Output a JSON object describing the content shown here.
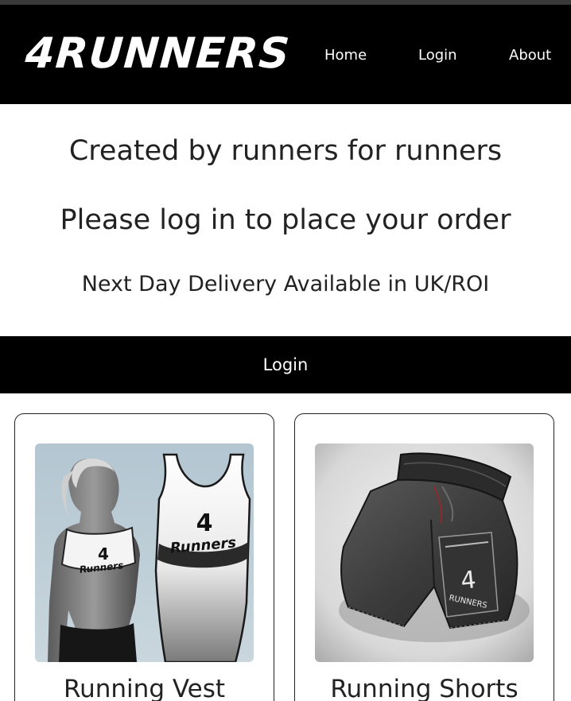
{
  "header": {
    "logo": "4RUNNERS",
    "nav": {
      "home": "Home",
      "login": "Login",
      "about": "About"
    }
  },
  "hero": {
    "line1": "Created by runners for runners",
    "line2": "Please log in to place your order",
    "line3": "Next Day Delivery Available in UK/ROI"
  },
  "login_bar": {
    "label": "Login"
  },
  "products": [
    {
      "title": "Running Vest",
      "image_icon": "running-vest-image",
      "print": "4",
      "print_script": "Runners"
    },
    {
      "title": "Running Shorts",
      "image_icon": "running-shorts-image",
      "print": "4",
      "print_script": "RUNNERS"
    }
  ],
  "colors": {
    "header_bg": "#000000",
    "page_bg": "#ffffff",
    "text": "#222222"
  }
}
